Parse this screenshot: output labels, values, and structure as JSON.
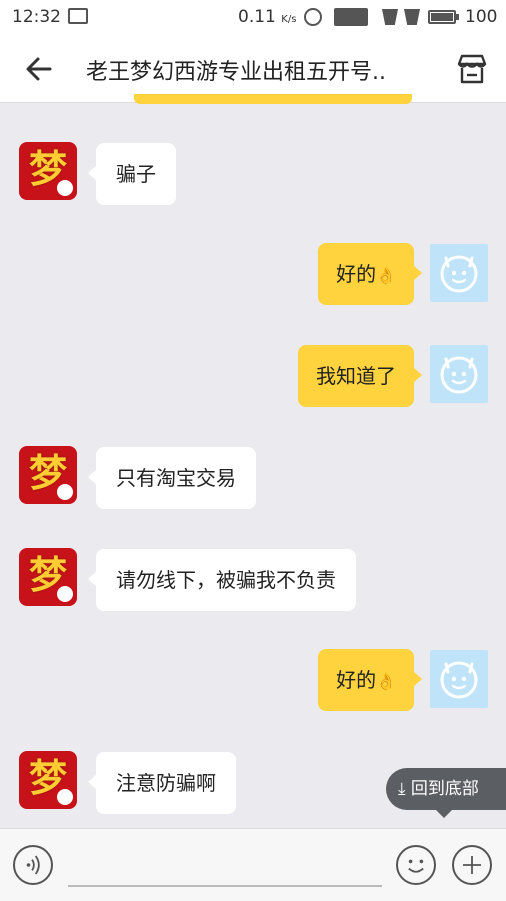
{
  "status_bar": {
    "time": "12:32",
    "net_speed": "0.11",
    "net_unit": "K/s",
    "battery": "100"
  },
  "header": {
    "title": "老王梦幻西游专业出租五开号.."
  },
  "avatar_left_glyph": "梦",
  "messages": [
    {
      "side": "left",
      "text": "骗子"
    },
    {
      "side": "right",
      "text": "好的",
      "emoji": "👌"
    },
    {
      "side": "right",
      "text": "我知道了"
    },
    {
      "side": "left",
      "text": "只有淘宝交易"
    },
    {
      "side": "left",
      "text": "请勿线下，被骗我不负责"
    },
    {
      "side": "right",
      "text": "好的",
      "emoji": "👌"
    },
    {
      "side": "left",
      "text": "注意防骗啊"
    }
  ],
  "jump_to_bottom": "回到底部",
  "colors": {
    "chat_bg": "#ebebef",
    "my_bubble": "#ffd33d",
    "their_bubble": "#ffffff",
    "my_avatar": "#bfe3f8",
    "their_avatar": "#c8121a"
  },
  "icons": [
    "back-arrow-icon",
    "shop-icon",
    "voice-icon",
    "emoji-icon",
    "plus-icon",
    "download-arrow-icon"
  ]
}
